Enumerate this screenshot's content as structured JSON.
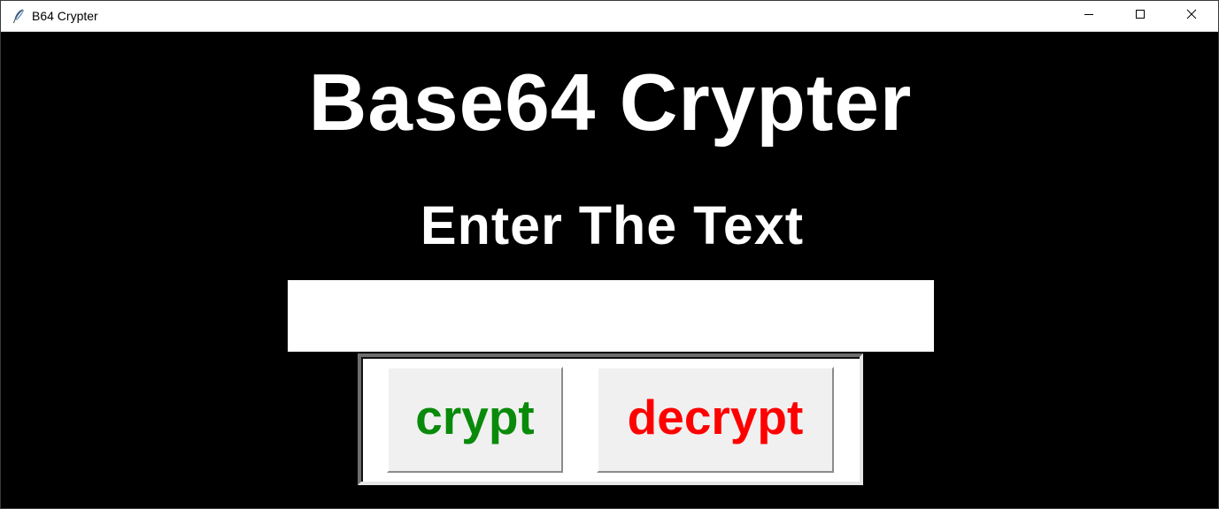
{
  "window": {
    "title": "B64 Crypter",
    "controls": {
      "minimize": "minimize-icon",
      "maximize": "maximize-icon",
      "close": "close-icon"
    }
  },
  "main": {
    "heading": "Base64 Crypter",
    "subheading": "Enter The Text",
    "input": {
      "value": "",
      "placeholder": ""
    },
    "buttons": {
      "crypt": {
        "label": "crypt",
        "color": "#0a8a0a"
      },
      "decrypt": {
        "label": "decrypt",
        "color": "#ff0000"
      }
    }
  },
  "colors": {
    "background": "#000000",
    "text": "#ffffff",
    "button_face": "#f0f0f0"
  }
}
